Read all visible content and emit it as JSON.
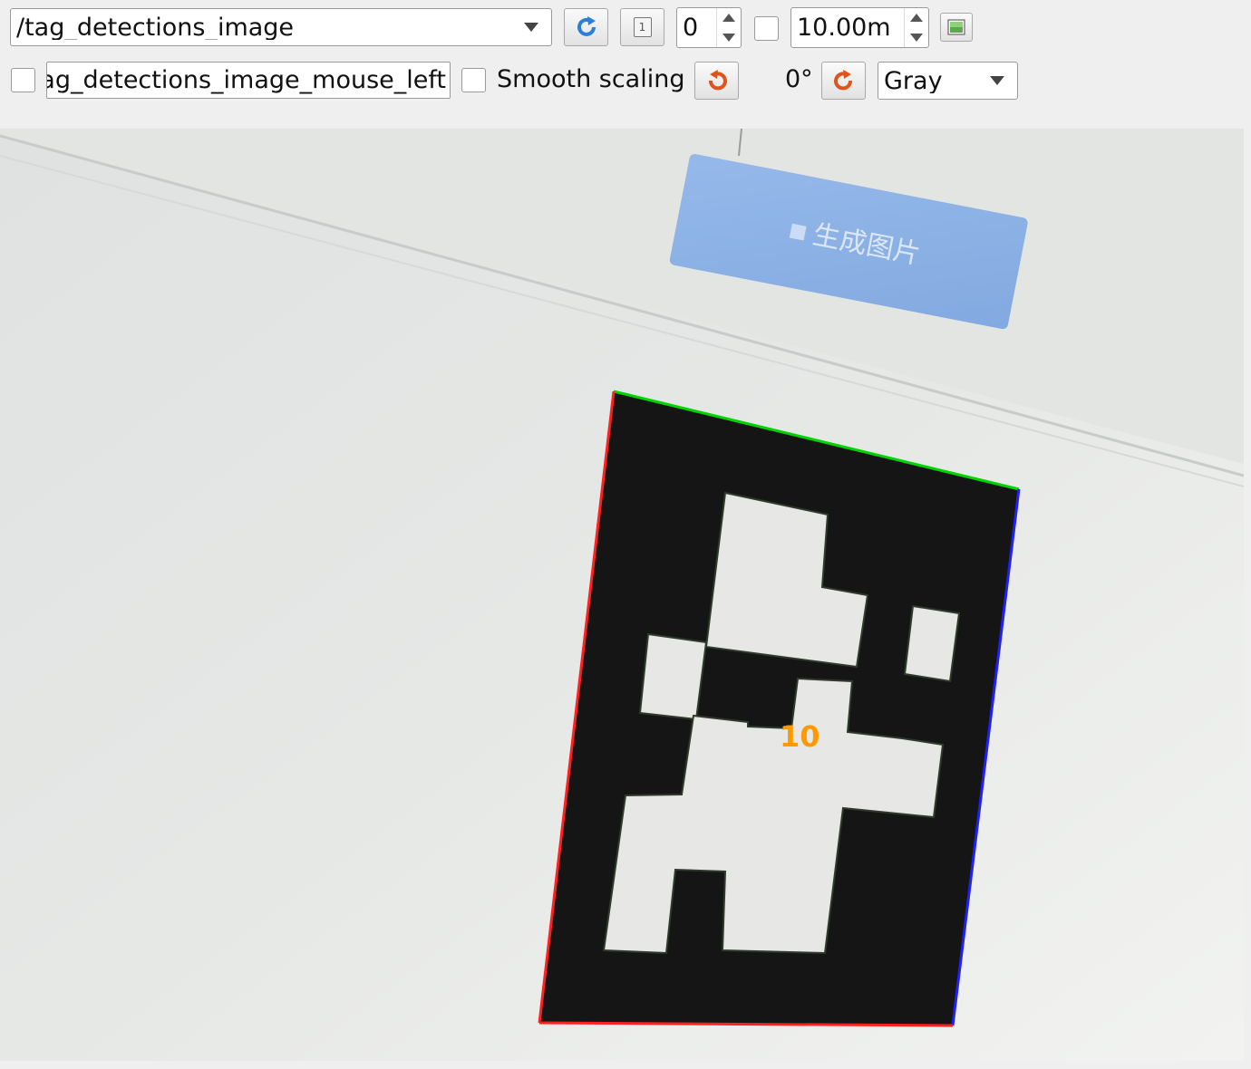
{
  "toolbar": {
    "topic": "/tag_detections_image",
    "frame_index": "0",
    "time_window": "10.00m",
    "mouse_topic": "ag_detections_image_mouse_left",
    "smooth_scaling_label": "Smooth scaling",
    "smooth_scaling_checked": false,
    "rotation": "0°",
    "color_scheme": "Gray",
    "index_icon_text": "1"
  },
  "image": {
    "sign_text": "生成图片",
    "tag_id_label": "10",
    "tag_label_color": "#ff9900"
  }
}
